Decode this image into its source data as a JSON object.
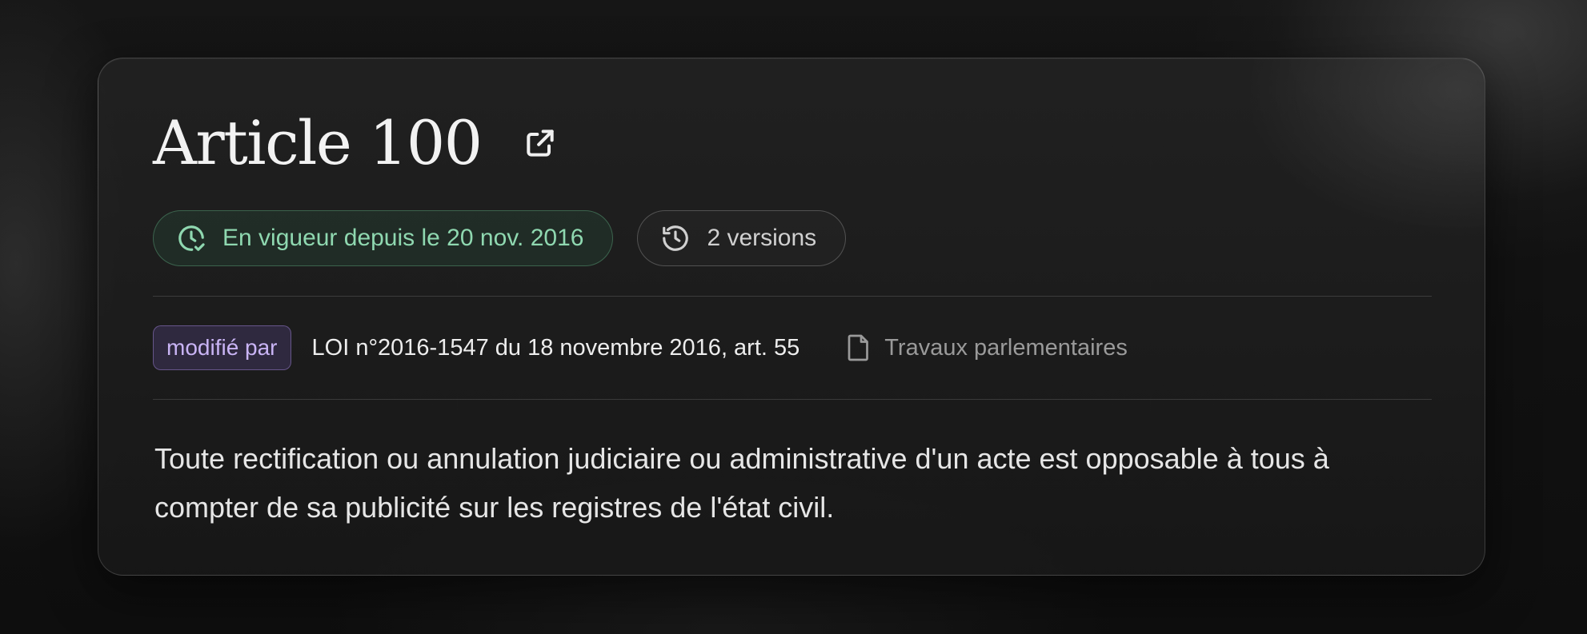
{
  "article": {
    "title": "Article 100",
    "external_link_icon": "external-link-icon"
  },
  "status": {
    "in_force_label": "En vigueur depuis le 20 nov. 2016",
    "in_force_icon": "clock-check-icon",
    "versions_label": "2 versions",
    "versions_icon": "history-icon"
  },
  "modification": {
    "tag_label": "modifié par",
    "law_reference": "LOI n°2016-1547 du 18 novembre 2016, art. 55",
    "travaux_label": "Travaux parlementaires",
    "travaux_icon": "document-icon"
  },
  "content": {
    "text": "Toute rectification ou annulation judiciaire ou administrative d'un acte est opposable à tous à compter de sa publicité sur les registres de l'état civil."
  },
  "colors": {
    "accent_green": "#8fd8b0",
    "accent_purple": "#c9b4f5",
    "background": "#111111"
  }
}
